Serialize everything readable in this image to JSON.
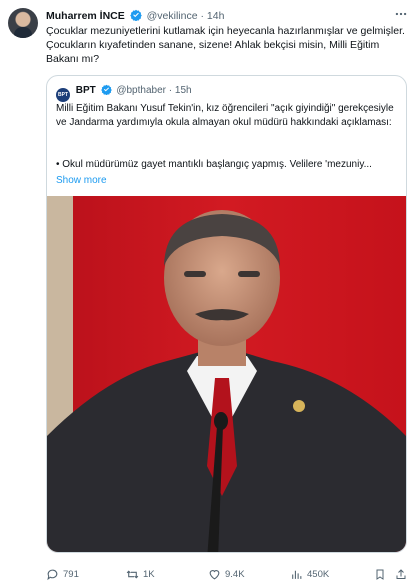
{
  "author": {
    "name": "Muharrem İNCE",
    "handle": "@vekilince",
    "separator": "·",
    "time": "14h",
    "more_icon": "more-icon",
    "verified_color": "#1d9bf0"
  },
  "tweet": {
    "text": "Çocuklar mezuniyetlerini kutlamak için heyecanla hazırlanmışlar ve gelmişler. Çocukların kıyafetinden sanane, sizene! Ahlak bekçisi misin, Milli Eğitim Bakanı mı?"
  },
  "quote": {
    "avatar_text": "BPT",
    "name": "BPT",
    "handle": "@bpthaber",
    "separator": "·",
    "time": "15h",
    "text": "Milli Eğitim Bakanı Yusuf Tekin'in, kız öğrencileri \"açık giyindiği\" gerekçesiyle ve Jandarma yardımıyla okula almayan okul müdürü hakkındaki açıklaması:",
    "text2": "• Okul müdürümüz gayet mantıklı başlangıç yapmış. Velilere 'mezuniy...",
    "show_more": "Show more",
    "photo": "portrait-photo"
  },
  "actions": {
    "replies": "791",
    "reposts": "1K",
    "likes": "9.4K",
    "views": "450K"
  },
  "colors": {
    "link": "#1d9bf0",
    "muted": "#536471",
    "border": "#cfd9de"
  }
}
